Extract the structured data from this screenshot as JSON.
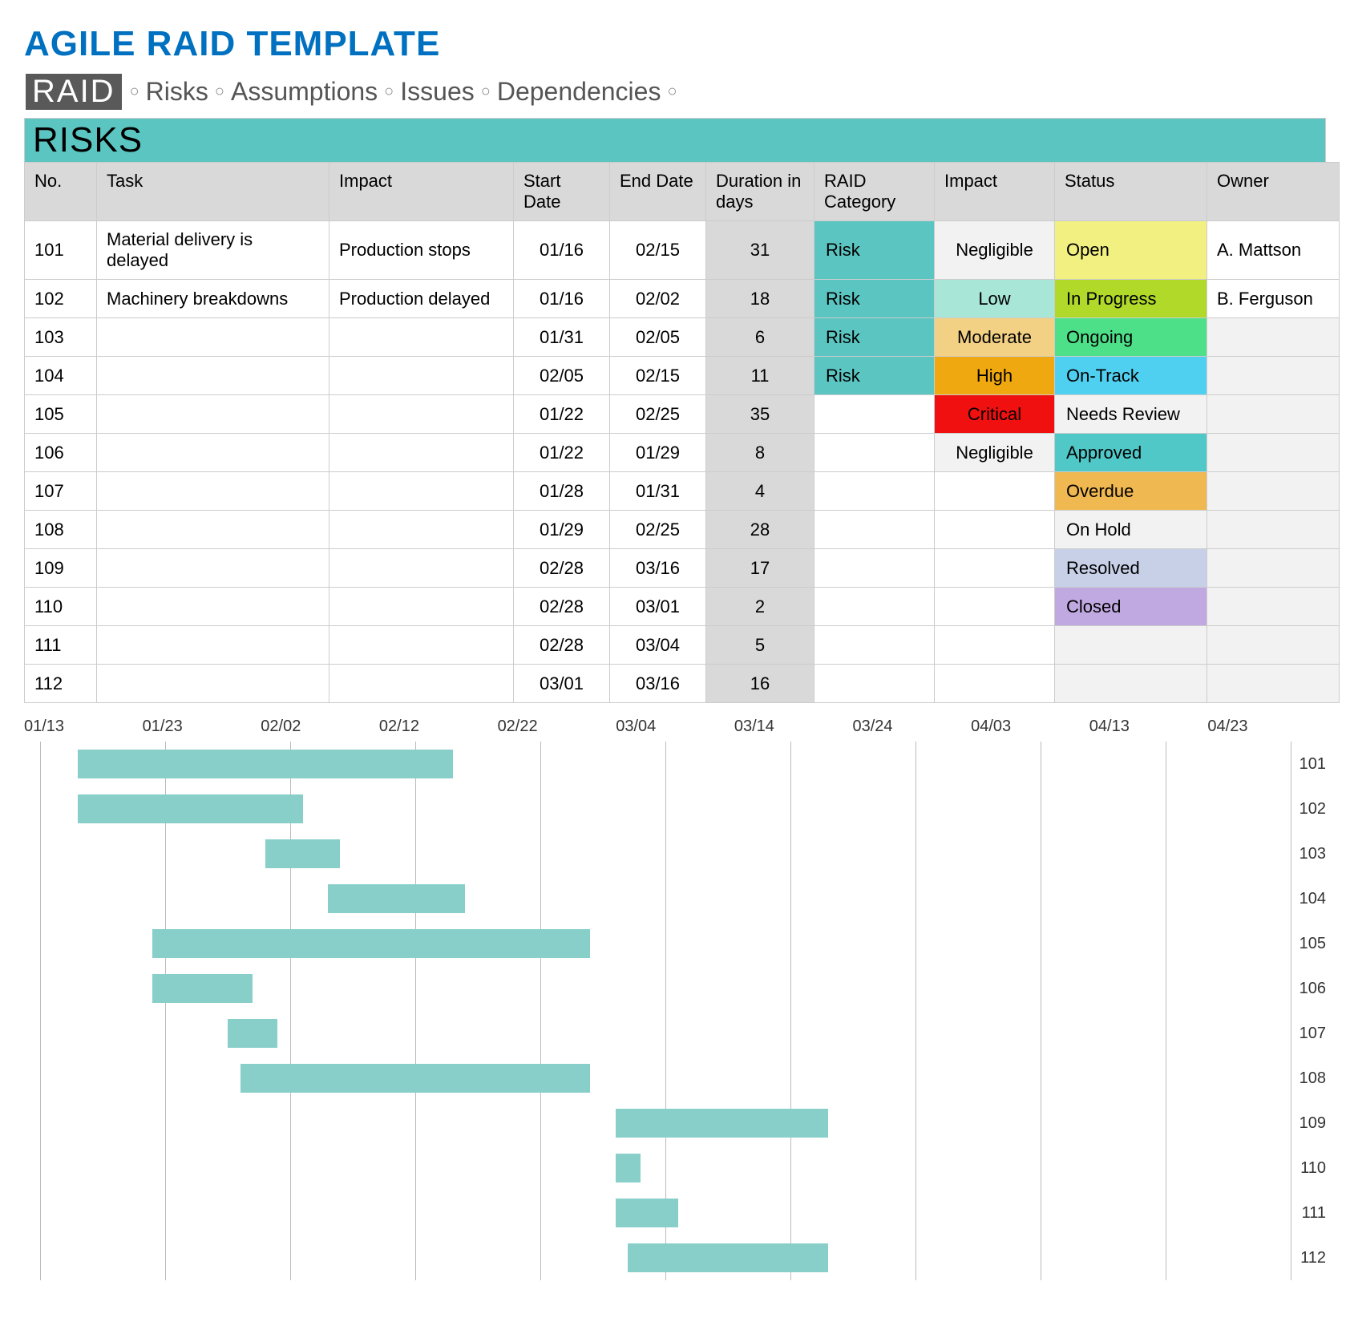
{
  "title": "AGILE RAID TEMPLATE",
  "raid_badge": "RAID",
  "acronym": [
    "Risks",
    "Assumptions",
    "Issues",
    "Dependencies"
  ],
  "section_title": "RISKS",
  "columns": {
    "no": "No.",
    "task": "Task",
    "impact1": "Impact",
    "start": "Start Date",
    "end": "End Date",
    "duration": "Duration in days",
    "category": "RAID Category",
    "impact2": "Impact",
    "status": "Status",
    "owner": "Owner"
  },
  "rows": [
    {
      "no": "101",
      "task": "Material delivery is delayed",
      "impact1": "Production stops",
      "start": "01/16",
      "end": "02/15",
      "dur": "31",
      "cat": "Risk",
      "catColor": "#5BC5C2",
      "imp": "Negligible",
      "impColor": "#F2F2F2",
      "status": "Open",
      "statusColor": "#F2F080",
      "owner": "A. Mattson"
    },
    {
      "no": "102",
      "task": "Machinery breakdowns",
      "impact1": "Production delayed",
      "start": "01/16",
      "end": "02/02",
      "dur": "18",
      "cat": "Risk",
      "catColor": "#5BC5C2",
      "imp": "Low",
      "impColor": "#A8E6D8",
      "status": "In Progress",
      "statusColor": "#B0D92A",
      "owner": "B. Ferguson"
    },
    {
      "no": "103",
      "task": "",
      "impact1": "",
      "start": "01/31",
      "end": "02/05",
      "dur": "6",
      "cat": "Risk",
      "catColor": "#5BC5C2",
      "imp": "Moderate",
      "impColor": "#F2D084",
      "status": "Ongoing",
      "statusColor": "#4EE088",
      "owner": ""
    },
    {
      "no": "104",
      "task": "",
      "impact1": "",
      "start": "02/05",
      "end": "02/15",
      "dur": "11",
      "cat": "Risk",
      "catColor": "#5BC5C2",
      "imp": "High",
      "impColor": "#F0A810",
      "status": "On-Track",
      "statusColor": "#50D0F0",
      "owner": ""
    },
    {
      "no": "105",
      "task": "",
      "impact1": "",
      "start": "01/22",
      "end": "02/25",
      "dur": "35",
      "cat": "",
      "catColor": "",
      "imp": "Critical",
      "impColor": "#F01010",
      "status": "Needs Review",
      "statusColor": "#F2F2F2",
      "owner": ""
    },
    {
      "no": "106",
      "task": "",
      "impact1": "",
      "start": "01/22",
      "end": "01/29",
      "dur": "8",
      "cat": "",
      "catColor": "",
      "imp": "Negligible",
      "impColor": "#F2F2F2",
      "status": "Approved",
      "statusColor": "#50C8C8",
      "owner": ""
    },
    {
      "no": "107",
      "task": "",
      "impact1": "",
      "start": "01/28",
      "end": "01/31",
      "dur": "4",
      "cat": "",
      "catColor": "",
      "imp": "",
      "impColor": "",
      "status": "Overdue",
      "statusColor": "#F0B850",
      "owner": ""
    },
    {
      "no": "108",
      "task": "",
      "impact1": "",
      "start": "01/29",
      "end": "02/25",
      "dur": "28",
      "cat": "",
      "catColor": "",
      "imp": "",
      "impColor": "",
      "status": "On Hold",
      "statusColor": "#F2F2F2",
      "owner": ""
    },
    {
      "no": "109",
      "task": "",
      "impact1": "",
      "start": "02/28",
      "end": "03/16",
      "dur": "17",
      "cat": "",
      "catColor": "",
      "imp": "",
      "impColor": "",
      "status": "Resolved",
      "statusColor": "#C8D0E8",
      "owner": ""
    },
    {
      "no": "110",
      "task": "",
      "impact1": "",
      "start": "02/28",
      "end": "03/01",
      "dur": "2",
      "cat": "",
      "catColor": "",
      "imp": "",
      "impColor": "",
      "status": "Closed",
      "statusColor": "#C0A8E0",
      "owner": ""
    },
    {
      "no": "111",
      "task": "",
      "impact1": "",
      "start": "02/28",
      "end": "03/04",
      "dur": "5",
      "cat": "",
      "catColor": "",
      "imp": "",
      "impColor": "",
      "status": "",
      "statusColor": "#F2F2F2",
      "owner": ""
    },
    {
      "no": "112",
      "task": "",
      "impact1": "",
      "start": "03/01",
      "end": "03/16",
      "dur": "16",
      "cat": "",
      "catColor": "",
      "imp": "",
      "impColor": "",
      "status": "",
      "statusColor": "#F2F2F2",
      "owner": ""
    }
  ],
  "chart_data": {
    "type": "gantt",
    "x_axis_ticks": [
      "01/13",
      "01/23",
      "02/02",
      "02/12",
      "02/22",
      "03/04",
      "03/14",
      "03/24",
      "04/03",
      "04/13",
      "04/23"
    ],
    "x_range_days": {
      "start": 13,
      "end": 113
    },
    "series": [
      {
        "id": "101",
        "start_day": 16,
        "end_day": 46
      },
      {
        "id": "102",
        "start_day": 16,
        "end_day": 34
      },
      {
        "id": "103",
        "start_day": 31,
        "end_day": 37
      },
      {
        "id": "104",
        "start_day": 36,
        "end_day": 47
      },
      {
        "id": "105",
        "start_day": 22,
        "end_day": 57
      },
      {
        "id": "106",
        "start_day": 22,
        "end_day": 30
      },
      {
        "id": "107",
        "start_day": 28,
        "end_day": 32
      },
      {
        "id": "108",
        "start_day": 29,
        "end_day": 57
      },
      {
        "id": "109",
        "start_day": 59,
        "end_day": 76
      },
      {
        "id": "110",
        "start_day": 59,
        "end_day": 61
      },
      {
        "id": "111",
        "start_day": 59,
        "end_day": 64
      },
      {
        "id": "112",
        "start_day": 60,
        "end_day": 76
      }
    ]
  }
}
